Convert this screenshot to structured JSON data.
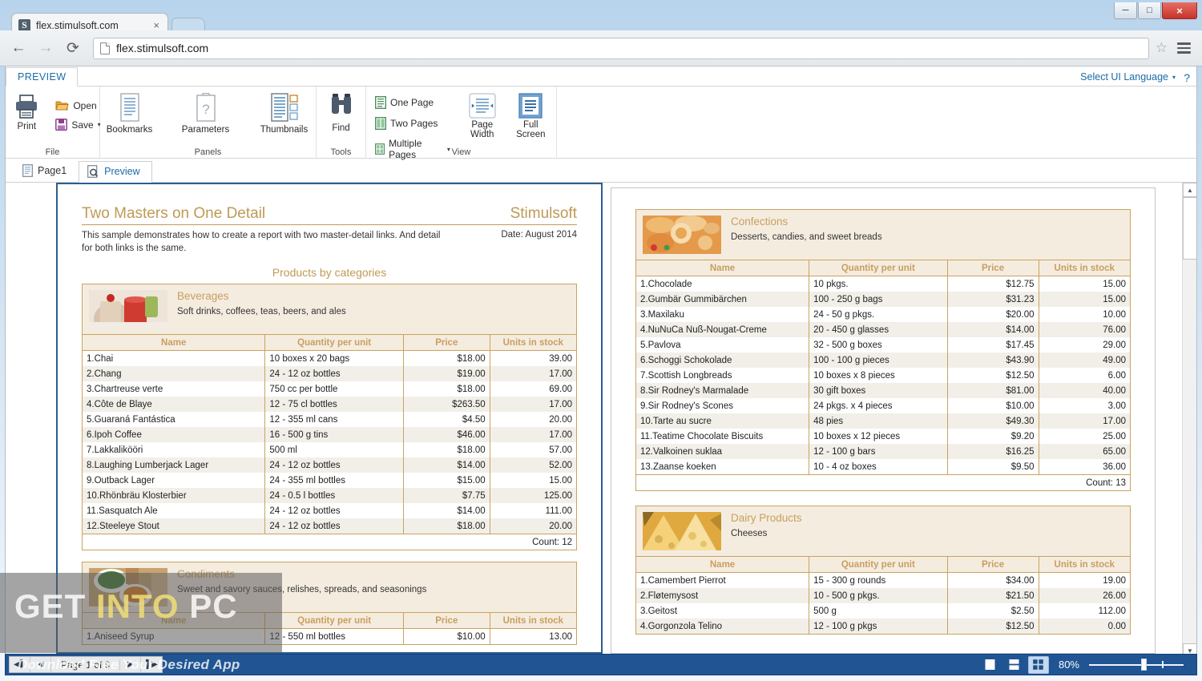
{
  "browser": {
    "tab_title": "flex.stimulsoft.com",
    "tab_close": "×",
    "favicon_letter": "S",
    "url": "flex.stimulsoft.com",
    "back_icon": "←",
    "forward_icon": "→",
    "reload_icon": "⟳",
    "star_icon": "☆",
    "minimize": "─",
    "maximize": "□",
    "close": "×"
  },
  "ribbon": {
    "tab_preview": "PREVIEW",
    "ui_language": "Select UI Language",
    "ui_language_caret": "▾",
    "help": "?",
    "groups": [
      {
        "label": "File",
        "items": [
          "Print",
          "Open",
          "Save"
        ]
      },
      {
        "label": "Panels",
        "items": [
          "Bookmarks",
          "Parameters",
          "Thumbnails"
        ]
      },
      {
        "label": "Tools",
        "items": [
          "Find"
        ]
      },
      {
        "label": "View",
        "items": [
          "One Page",
          "Two Pages",
          "Multiple Pages",
          "Page Width",
          "Full Screen"
        ]
      }
    ],
    "print_label": "Print",
    "open_label": "Open",
    "save_label": "Save",
    "save_caret": "▾",
    "bookmarks_label": "Bookmarks",
    "parameters_label": "Parameters",
    "thumbnails_label": "Thumbnails",
    "find_label": "Find",
    "one_page_label": "One Page",
    "two_pages_label": "Two Pages",
    "multiple_pages_label": "Multiple Pages",
    "multiple_pages_caret": "▾",
    "page_width_label_1": "Page",
    "page_width_label_2": "Width",
    "full_screen_label_1": "Full",
    "full_screen_label_2": "Screen",
    "group_file": "File",
    "group_panels": "Panels",
    "group_tools": "Tools",
    "group_view": "View"
  },
  "page_tabs": [
    {
      "label": "Page1",
      "active": false
    },
    {
      "label": "Preview",
      "active": true
    }
  ],
  "report": {
    "title": "Two Masters on One Detail",
    "brand": "Stimulsoft",
    "description": "This sample demonstrates how to create a report with two master-detail links. And detail for both links is the same.",
    "date": "Date: August 2014",
    "section_title": "Products by categories",
    "columns": [
      "Name",
      "Quantity per unit",
      "Price",
      "Units in stock"
    ],
    "count_prefix": "Count: "
  },
  "categories": [
    {
      "name": "Beverages",
      "description": "Soft drinks, coffees, teas, beers, and ales",
      "count": "Count: 12",
      "rows": [
        [
          "1.Chai",
          "10 boxes x 20 bags",
          "$18.00",
          "39.00"
        ],
        [
          "2.Chang",
          "24 - 12 oz bottles",
          "$19.00",
          "17.00"
        ],
        [
          "3.Chartreuse verte",
          "750 cc per bottle",
          "$18.00",
          "69.00"
        ],
        [
          "4.Côte de Blaye",
          "12 - 75 cl bottles",
          "$263.50",
          "17.00"
        ],
        [
          "5.Guaraná Fantástica",
          "12 - 355 ml cans",
          "$4.50",
          "20.00"
        ],
        [
          "6.Ipoh Coffee",
          "16 - 500 g tins",
          "$46.00",
          "17.00"
        ],
        [
          "7.Lakkalikööri",
          "500 ml",
          "$18.00",
          "57.00"
        ],
        [
          "8.Laughing Lumberjack Lager",
          "24 - 12 oz bottles",
          "$14.00",
          "52.00"
        ],
        [
          "9.Outback Lager",
          "24 - 355 ml bottles",
          "$15.00",
          "15.00"
        ],
        [
          "10.Rhönbräu Klosterbier",
          "24 - 0.5 l bottles",
          "$7.75",
          "125.00"
        ],
        [
          "11.Sasquatch Ale",
          "24 - 12 oz bottles",
          "$14.00",
          "111.00"
        ],
        [
          "12.Steeleye Stout",
          "24 - 12 oz bottles",
          "$18.00",
          "20.00"
        ]
      ]
    },
    {
      "name": "Condiments",
      "description": "Sweet and savory sauces, relishes, spreads, and seasonings",
      "count": "",
      "rows": [
        [
          "1.Aniseed Syrup",
          "12 - 550 ml bottles",
          "$10.00",
          "13.00"
        ]
      ]
    },
    {
      "name": "Confections",
      "description": "Desserts, candies, and sweet breads",
      "count": "Count: 13",
      "rows": [
        [
          "1.Chocolade",
          "10 pkgs.",
          "$12.75",
          "15.00"
        ],
        [
          "2.Gumbär Gummibärchen",
          "100 - 250 g bags",
          "$31.23",
          "15.00"
        ],
        [
          "3.Maxilaku",
          "24 - 50 g pkgs.",
          "$20.00",
          "10.00"
        ],
        [
          "4.NuNuCa Nuß-Nougat-Creme",
          "20 - 450 g glasses",
          "$14.00",
          "76.00"
        ],
        [
          "5.Pavlova",
          "32 - 500 g boxes",
          "$17.45",
          "29.00"
        ],
        [
          "6.Schoggi Schokolade",
          "100 - 100 g pieces",
          "$43.90",
          "49.00"
        ],
        [
          "7.Scottish Longbreads",
          "10 boxes x 8 pieces",
          "$12.50",
          "6.00"
        ],
        [
          "8.Sir Rodney's Marmalade",
          "30 gift boxes",
          "$81.00",
          "40.00"
        ],
        [
          "9.Sir Rodney's Scones",
          "24 pkgs. x 4 pieces",
          "$10.00",
          "3.00"
        ],
        [
          "10.Tarte au sucre",
          "48 pies",
          "$49.30",
          "17.00"
        ],
        [
          "11.Teatime Chocolate Biscuits",
          "10 boxes x 12 pieces",
          "$9.20",
          "25.00"
        ],
        [
          "12.Valkoinen suklaa",
          "12 - 100 g bars",
          "$16.25",
          "65.00"
        ],
        [
          "13.Zaanse koeken",
          "10 - 4 oz boxes",
          "$9.50",
          "36.00"
        ]
      ]
    },
    {
      "name": "Dairy Products",
      "description": "Cheeses",
      "count": "",
      "rows": [
        [
          "1.Camembert Pierrot",
          "15 - 300 g rounds",
          "$34.00",
          "19.00"
        ],
        [
          "2.Fløtemysost",
          "10 - 500 g pkgs.",
          "$21.50",
          "26.00"
        ],
        [
          "3.Geitost",
          "500 g",
          "$2.50",
          "112.00"
        ],
        [
          "4.Gorgonzola Telino",
          "12 - 100 g pkgs",
          "$12.50",
          "0.00"
        ]
      ]
    }
  ],
  "statusbar": {
    "first_icon": "◀│",
    "prev_icon": "◀",
    "page_text": "Page 1 of 9",
    "next_icon": "▶",
    "last_icon": "│▶",
    "zoom_value": "80%",
    "view_one_page": "one-page",
    "view_two_pages": "two-pages",
    "view_multiple_pages": "multiple-pages"
  },
  "watermark": {
    "line1_a": "GET ",
    "line1_b": "INTO",
    "line1_c": " PC",
    "subtitle": "Download Free Your Desired App"
  },
  "colors": {
    "accent_gold": "#c89f5e",
    "table_head_bg": "#f5ece0",
    "row_alt_bg": "#f2efe9",
    "border_gold": "#c9a35f",
    "link_blue": "#1b6ca8",
    "status_blue": "#205493",
    "page_border_active": "#2c5d8f"
  }
}
